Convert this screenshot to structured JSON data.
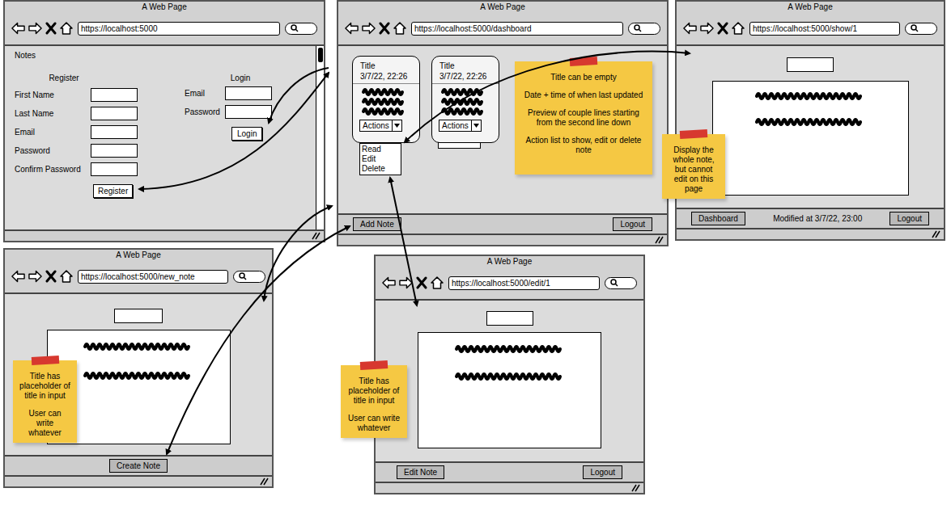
{
  "login_page": {
    "title": "A Web Page",
    "url": "https://localhost:5000",
    "app_name": "Notes",
    "register": {
      "heading": "Register",
      "fields": [
        "First Name",
        "Last Name",
        "Email",
        "Password",
        "Confirm Password"
      ],
      "button": "Register"
    },
    "login": {
      "heading": "Login",
      "fields": [
        "Email",
        "Password"
      ],
      "button": "Login"
    }
  },
  "dashboard_page": {
    "title": "A Web Page",
    "url": "https://localhost:5000/dashboard",
    "cards": [
      {
        "title": "Title",
        "date": "3/7/22, 22:26",
        "actions": "Actions",
        "menu_open": true
      },
      {
        "title": "Title",
        "date": "3/7/22, 22:26",
        "actions": "Actions",
        "menu_open": false
      }
    ],
    "menu_items": [
      "Read",
      "Edit",
      "Delete"
    ],
    "note": [
      "Title can be empty",
      "Date + time of when last updated",
      "Preview of couple lines starting from the second line down",
      "Action list to show, edit or delete note"
    ],
    "buttons": [
      "Add Note",
      "Logout"
    ]
  },
  "show_page": {
    "title": "A Web Page",
    "url": "https://localhost:5000/show/1",
    "note": [
      "Display the whole note, but cannot edit on this page"
    ],
    "buttons": [
      "Dashboard",
      "Logout"
    ],
    "modified": "Modified at 3/7/22, 23:00"
  },
  "new_note_page": {
    "title": "A Web Page",
    "url": "https://localhost:5000/new_note",
    "note": [
      "Title has placeholder of title in input",
      "User can write whatever"
    ],
    "buttons": [
      "Create Note"
    ]
  },
  "edit_page": {
    "title": "A Web Page",
    "url": "https://localhost:5000/edit/1",
    "note": [
      "Title has placeholder of title in input",
      "User can write whatever"
    ],
    "buttons": [
      "Edit Note",
      "Logout"
    ]
  }
}
